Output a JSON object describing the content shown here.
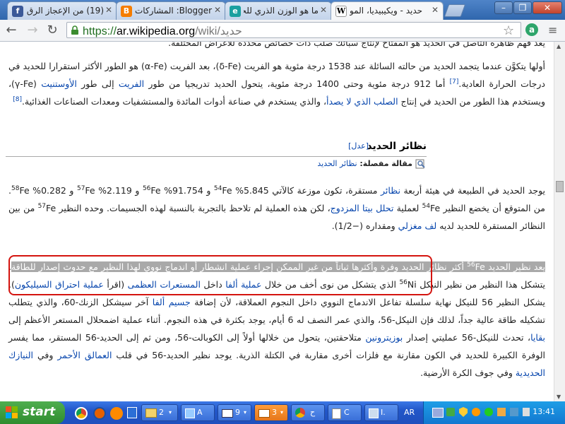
{
  "tabs": [
    {
      "label": "(19) من الإعجاز الرق...",
      "icon": "facebook-icon",
      "active": false
    },
    {
      "label": "Blogger: المشاركات",
      "icon": "blogger-icon",
      "active": false
    },
    {
      "label": "ما هو الوزن الذري للحـ",
      "icon": "tab-e-icon",
      "active": false
    },
    {
      "label": "حديد - ويكيبيديا، المو",
      "icon": "wikipedia-icon",
      "active": true
    }
  ],
  "toolbar": {
    "url_scheme": "https://",
    "url_host": "ar.wikipedia.org",
    "url_path": "/wiki/حديد"
  },
  "article": {
    "partial_top_line": "يعد فهم ظاهرة التآصل في الحديد هو المفتاح لإنتاج سبائك صلب ذات خصائص محددة للأغراض المختلفة.",
    "para1": {
      "t1": "أولها يتكوَّن عندما يتجمد الحديد من حالته السائلة عند 1538 درجة مئوية هو الفريت ",
      "t2": "(δ-Fe)",
      "t3": "، بعد الفريت ",
      "t4": "(α-Fe)",
      "t5": " هو الطور الأكثر استقرارا للحديد في درجات الحرارة العادية.",
      "ref1": "[7]",
      "t6": " أما 912 درجة مئوية وحتى 1400 درجة مئوية، يتحول الحديد تدريجيا من طور ",
      "l1": "الفريت",
      "t7": " إلى طور ",
      "l2": "الأوستنيت",
      "t8": " (γ-Fe)، ويستخدم هذا الطور من الحديد في إنتاج ",
      "l3": "الصلب الذي لا يصدأ",
      "t9": "، والذي يستخدم في صناعة أدوات المائدة والمستشفيات ومعدات الصناعات الغذائية.",
      "ref2": "[8]"
    },
    "section_title": "نظائر الحديد",
    "edit_label": "[عدل]",
    "main_article_prefix": "مقالة مفصلة: ",
    "main_article_link": "نظائر الحديد",
    "para2": {
      "t1": "يوجد الحديد في الطبيعة في هيئة أربعة ",
      "l1": "نظائر",
      "t2": " مستقرة، تكون موزعة كالآتي 5.845% ",
      "s1": "54",
      "t3": "Fe و 91.754% ",
      "s2": "56",
      "t4": "Fe و 2.119% ",
      "s3": "57",
      "t5": "Fe و 0.282% ",
      "s4": "58",
      "t6": "Fe. من المتوقع أن يخضع النظير ",
      "s5": "54",
      "t7": "Fe لعملية ",
      "l2": "تحلل بيتا المزدوج",
      "t8": "، لكن هذه العملية لم تلاحظ بالتجربة بالنسبة لهذه الجسيمات. وحده النظير ",
      "s6": "57",
      "t9": "Fe من بين النظائر المستقرة للحديد لديه ",
      "l3": "لف مغزلي",
      "t10": " ومقداره (−1/2)."
    },
    "para3": {
      "h1": "يعد نظير الحديد ",
      "s1": "56",
      "h2": "Fe أكثر نظائر الحديد وفرة وأكثرها ثباتاً من غير الممكن إجراء عملية انشطار أو اندماج نووي لهذا النظير مع حدوث إصدار للطاقة",
      "t1": ". يتشكل هذا النظير من نظير النيكل ",
      "s2": "56",
      "t2": "Ni الذي يتشكل من نوى أخف من خلال ",
      "l1": "عملية ألفا",
      "t3": " داخل ",
      "l2": "المستعرات العظمى",
      "t4": " (اقرأ ",
      "l3": "عملية احتراق السيليكون",
      "t5": "). يشكل النظير 56 للنيكل نهاية سلسلة تفاعل الاندماج النووي داخل النجوم العملاقة، لأن إضافة ",
      "l4": "جسيم ألفا",
      "t6": " آخر سيشكل الزنك-60، والذي يتطلب تشكيله طاقة عالية جداً، لذلك فإن النيكل-56، والذي عمر النصف له 6 أيام، يوجد بكثرة في هذه النجوم. أثناء عملية اضمحلال المستعر الأعظم إلى ",
      "l5": "بقايا",
      "t7": "، تحدث للنيكل-56 عمليتي إصدار ",
      "l6": "بوزيترونين",
      "t8": " متلاحقتين، يتحول من خلالها أولاً إلى الكوبالت-56، ومن ثم إلى الحديد-56 المستقر، مما يفسر الوفرة الكبيرة للحديد في الكون مقارنة مع فلزات أخرى مقاربة في الكتلة الذرية. يوجد نظير الحديد-56 في قلب ",
      "l7": "العمالق الأحمر",
      "t9": " وفي ",
      "l8": "النيازك الحديدية",
      "t10": " وفي جوف الكرة الأرضية."
    }
  },
  "taskbar": {
    "start_label": "start",
    "items": [
      {
        "label": "2",
        "icon": "folder-icon"
      },
      {
        "label": "A",
        "icon": "app-icon"
      },
      {
        "label": "9",
        "icon": "window-icon"
      },
      {
        "label": "3",
        "icon": "multi-window-icon",
        "active": true
      },
      {
        "label": "ح",
        "icon": "chrome-icon"
      },
      {
        "label": "C",
        "icon": "document-icon"
      },
      {
        "label": "I.",
        "icon": "app-icon-2"
      }
    ],
    "language": "AR",
    "clock": "13:41"
  },
  "colors": {
    "link": "#0645ad",
    "highlight_border": "#d4140f",
    "url_green": "#1f6d1f",
    "taskbar_blue": "#2256c8",
    "start_green": "#2f8c2f"
  }
}
